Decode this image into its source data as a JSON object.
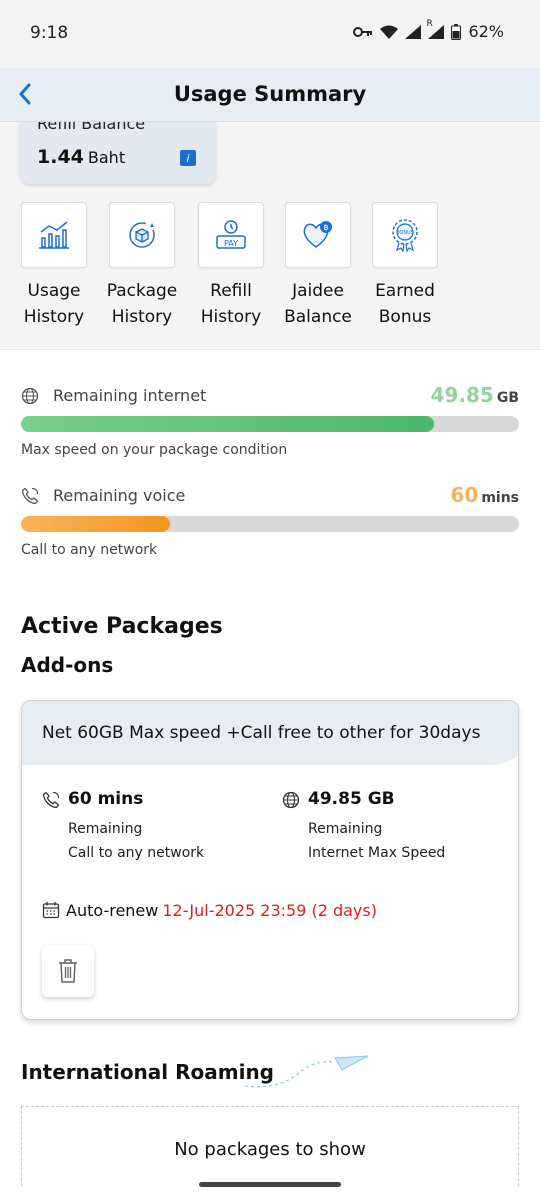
{
  "status_bar": {
    "time": "9:18",
    "battery": "62%",
    "signal_badge": "R"
  },
  "header": {
    "title": "Usage Summary"
  },
  "refill": {
    "label": "Refill Balance",
    "amount": "1.44",
    "unit": "Baht"
  },
  "quick_actions": [
    {
      "label": "Usage\nHistory",
      "icon": "usage-chart-icon"
    },
    {
      "label": "Package\nHistory",
      "icon": "package-history-icon"
    },
    {
      "label": "Refill\nHistory",
      "icon": "refill-pay-icon"
    },
    {
      "label": "Jaidee\nBalance",
      "icon": "jaidee-heart-icon"
    },
    {
      "label": "Earned\nBonus",
      "icon": "bonus-badge-icon"
    }
  ],
  "usage": {
    "internet": {
      "label": "Remaining internet",
      "value": "49.85",
      "unit": "GB",
      "fill_fraction": 0.83,
      "note": "Max speed on your package condition",
      "color": "#5cc07a"
    },
    "voice": {
      "label": "Remaining voice",
      "value": "60",
      "unit": "mins",
      "fill_fraction": 0.3,
      "note": "Call to any network",
      "color": "#f5a33a"
    }
  },
  "active_packages": {
    "title": "Active Packages",
    "subtitle": "Add-ons",
    "package": {
      "name": "Net 60GB Max speed +Call free to other for 30days",
      "voice_value": "60 mins",
      "voice_l1": "Remaining",
      "voice_l2": "Call to any network",
      "data_value": "49.85 GB",
      "data_l1": "Remaining",
      "data_l2": "Internet Max Speed",
      "renew_label": "Auto-renew",
      "renew_date": "12-Jul-2025 23:59 (2 days)"
    }
  },
  "roaming": {
    "title": "International Roaming",
    "empty_message": "No packages to show"
  },
  "colors": {
    "accent_blue": "#1b6fd4",
    "alert_red": "#e01e1e"
  }
}
